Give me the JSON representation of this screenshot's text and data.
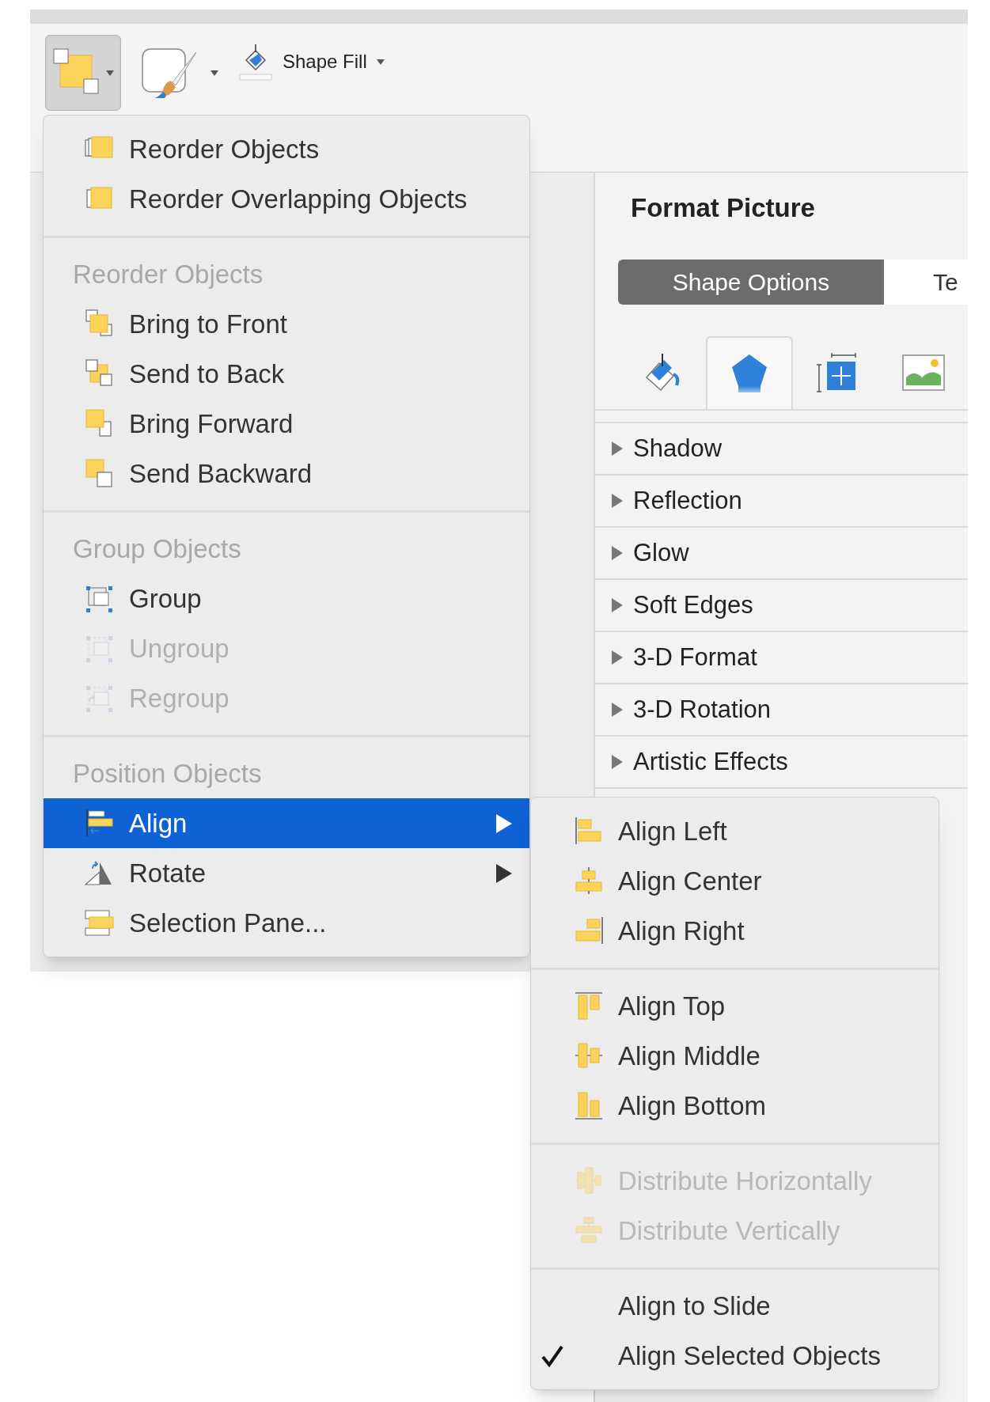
{
  "toolbar": {
    "buttons": [
      {
        "kind": "arrange",
        "selected": true
      },
      {
        "kind": "styles",
        "selected": false
      }
    ],
    "shape_fill": {
      "label": "Shape Fill"
    }
  },
  "format_pane": {
    "title": "Format Picture",
    "tabs": [
      {
        "label": "Shape Options",
        "selected": true
      },
      {
        "label": "Te",
        "selected": false
      }
    ],
    "icon_tabs": [
      {
        "kind": "fill",
        "selected": false
      },
      {
        "kind": "effects",
        "selected": true
      },
      {
        "kind": "size",
        "selected": false
      },
      {
        "kind": "picture",
        "selected": false
      }
    ],
    "sections": [
      {
        "label": "Shadow",
        "expanded": false
      },
      {
        "label": "Reflection",
        "expanded": false
      },
      {
        "label": "Glow",
        "expanded": false
      },
      {
        "label": "Soft Edges",
        "expanded": false
      },
      {
        "label": "3-D Format",
        "expanded": false
      },
      {
        "label": "3-D Rotation",
        "expanded": false
      },
      {
        "label": "Artistic Effects",
        "expanded": false
      }
    ]
  },
  "arrange_menu": {
    "groups": [
      {
        "items": [
          {
            "label": "Reorder Objects",
            "kind": "reorder",
            "disabled": false,
            "selected": false,
            "submenu": false
          },
          {
            "label": "Reorder Overlapping Objects",
            "kind": "reorder-overlap",
            "disabled": false,
            "selected": false,
            "submenu": false
          }
        ]
      },
      {
        "header": "Reorder Objects",
        "items": [
          {
            "label": "Bring to Front",
            "kind": "bring-front",
            "disabled": false,
            "selected": false,
            "submenu": false
          },
          {
            "label": "Send to Back",
            "kind": "send-back",
            "disabled": false,
            "selected": false,
            "submenu": false
          },
          {
            "label": "Bring Forward",
            "kind": "bring-forward",
            "disabled": false,
            "selected": false,
            "submenu": false
          },
          {
            "label": "Send Backward",
            "kind": "send-backward",
            "disabled": false,
            "selected": false,
            "submenu": false
          }
        ]
      },
      {
        "header": "Group Objects",
        "items": [
          {
            "label": "Group",
            "kind": "group",
            "disabled": false,
            "selected": false,
            "submenu": false
          },
          {
            "label": "Ungroup",
            "kind": "ungroup",
            "disabled": true,
            "selected": false,
            "submenu": false
          },
          {
            "label": "Regroup",
            "kind": "regroup",
            "disabled": true,
            "selected": false,
            "submenu": false
          }
        ]
      },
      {
        "header": "Position Objects",
        "items": [
          {
            "label": "Align",
            "kind": "align",
            "disabled": false,
            "selected": true,
            "submenu": true
          },
          {
            "label": "Rotate",
            "kind": "rotate",
            "disabled": false,
            "selected": false,
            "submenu": true
          },
          {
            "label": "Selection Pane...",
            "kind": "selection-pane",
            "disabled": false,
            "selected": false,
            "submenu": false
          }
        ]
      }
    ]
  },
  "align_submenu": {
    "groups": [
      {
        "items": [
          {
            "label": "Align Left",
            "kind": "align-left",
            "disabled": false,
            "checked": false
          },
          {
            "label": "Align Center",
            "kind": "align-center",
            "disabled": false,
            "checked": false
          },
          {
            "label": "Align Right",
            "kind": "align-right",
            "disabled": false,
            "checked": false
          }
        ]
      },
      {
        "items": [
          {
            "label": "Align Top",
            "kind": "align-top",
            "disabled": false,
            "checked": false
          },
          {
            "label": "Align Middle",
            "kind": "align-middle",
            "disabled": false,
            "checked": false
          },
          {
            "label": "Align Bottom",
            "kind": "align-bottom",
            "disabled": false,
            "checked": false
          }
        ]
      },
      {
        "items": [
          {
            "label": "Distribute Horizontally",
            "kind": "distribute-h",
            "disabled": true,
            "checked": false
          },
          {
            "label": "Distribute Vertically",
            "kind": "distribute-v",
            "disabled": true,
            "checked": false
          }
        ]
      },
      {
        "items": [
          {
            "label": "Align to Slide",
            "kind": "plain",
            "disabled": false,
            "checked": false
          },
          {
            "label": "Align Selected Objects",
            "kind": "plain",
            "disabled": false,
            "checked": true
          }
        ]
      }
    ]
  }
}
